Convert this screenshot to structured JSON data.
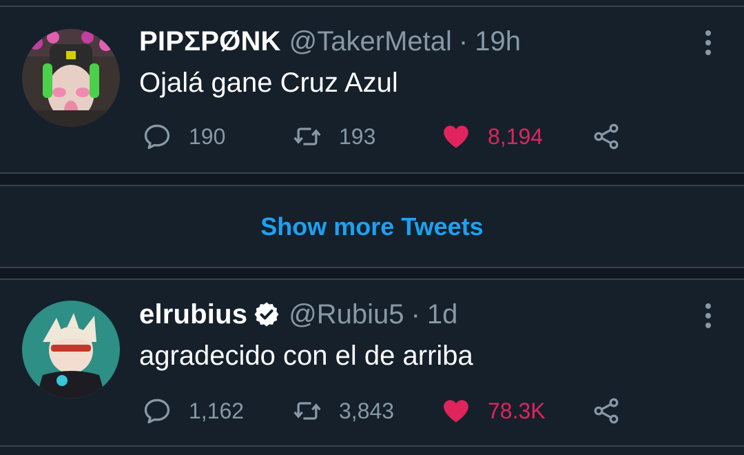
{
  "tweets": [
    {
      "name": "PIPΣPØNK",
      "handle": "@TakerMetal",
      "time": "19h",
      "separator": "·",
      "text": "Ojalá gane Cruz Azul",
      "verified": false,
      "replies": "190",
      "retweets": "193",
      "likes": "8,194",
      "liked": true,
      "avatar_icon": "avatar-streamer-headset"
    },
    {
      "name": "elrubius",
      "handle": "@Rubiu5",
      "time": "1d",
      "separator": "·",
      "text": "agradecido con el de arriba",
      "verified": true,
      "replies": "1,162",
      "retweets": "3,843",
      "likes": "78.3K",
      "liked": true,
      "avatar_icon": "avatar-anime-character"
    }
  ],
  "show_more": {
    "label": "Show more Tweets"
  },
  "colors": {
    "background": "#15202b",
    "divider": "#38444d",
    "muted": "#8899a6",
    "like": "#e0245e",
    "link": "#1da1f2"
  }
}
